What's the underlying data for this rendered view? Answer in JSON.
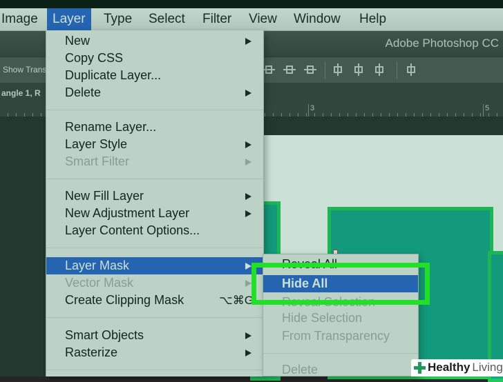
{
  "menubar": {
    "items": [
      {
        "label": "Image"
      },
      {
        "label": "Layer"
      },
      {
        "label": "Type"
      },
      {
        "label": "Select"
      },
      {
        "label": "Filter"
      },
      {
        "label": "View"
      },
      {
        "label": "Window"
      },
      {
        "label": "Help"
      }
    ],
    "active": "Layer"
  },
  "app_title": "Adobe Photoshop CC",
  "options_bar": {
    "show_transform": "Show Trans"
  },
  "document_tab": "angle 1, R",
  "ruler": {
    "marks": [
      "3",
      "5"
    ]
  },
  "layer_menu": {
    "items": [
      {
        "label": "New",
        "arrow": true
      },
      {
        "label": "Copy CSS"
      },
      {
        "label": "Duplicate Layer..."
      },
      {
        "label": "Delete",
        "arrow": true
      },
      {
        "label": "Rename Layer..."
      },
      {
        "label": "Layer Style",
        "arrow": true
      },
      {
        "label": "Smart Filter",
        "arrow": true,
        "disabled": true
      },
      {
        "label": "New Fill Layer",
        "arrow": true
      },
      {
        "label": "New Adjustment Layer",
        "arrow": true
      },
      {
        "label": "Layer Content Options..."
      },
      {
        "label": "Layer Mask",
        "arrow": true,
        "highlighted": true
      },
      {
        "label": "Vector Mask",
        "arrow": true,
        "disabled": true
      },
      {
        "label": "Create Clipping Mask",
        "shortcut": "⌥⌘G"
      },
      {
        "label": "Smart Objects",
        "arrow": true
      },
      {
        "label": "Rasterize",
        "arrow": true
      }
    ]
  },
  "layer_mask_submenu": {
    "items": [
      {
        "label": "Reveal All"
      },
      {
        "label": "Hide All",
        "highlighted": true
      },
      {
        "label": "Reveal Selection",
        "disabled": true
      },
      {
        "label": "Hide Selection",
        "disabled": true
      },
      {
        "label": "From Transparency",
        "disabled": true
      },
      {
        "label": "Delete",
        "disabled": true
      }
    ]
  },
  "watermark": {
    "brand_a": "Healthy",
    "brand_b": "Living"
  },
  "colors": {
    "menu_highlight": "#2a5fd0",
    "shape_fill": "#14a58e",
    "shape_stroke": "#21c85a",
    "callout_green": "#22e027"
  }
}
